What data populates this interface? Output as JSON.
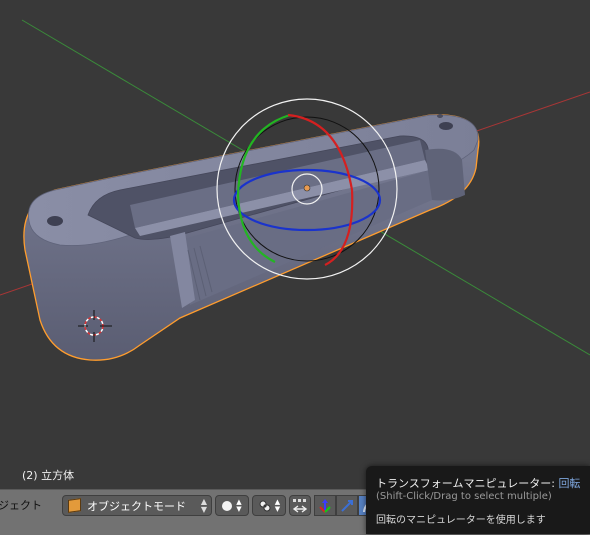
{
  "viewport": {
    "object_info": "(2) 立方体",
    "colors": {
      "background": "#393939",
      "axis_x": "#b03030",
      "axis_y": "#3a8a3a",
      "mesh": "#737790",
      "selection_outline": "#ff9d2e"
    }
  },
  "header": {
    "menu_object": "ジェクト",
    "mode_label": "オブジェクトモード",
    "mode_icon": "cube-icon",
    "shading_icon": "solid-sphere-icon",
    "pivot_icon": "pivot-point-icon",
    "snap_icon": "snap-icon",
    "manipulator_icons": [
      "translate-icon",
      "rotate-icon",
      "scale-icon"
    ]
  },
  "tooltip": {
    "title": "トランスフォームマニピュレーター:",
    "title_value": "回転",
    "hint": "(Shift-Click/Drag to select multiple)",
    "description": "回転のマニピュレーターを使用します"
  }
}
